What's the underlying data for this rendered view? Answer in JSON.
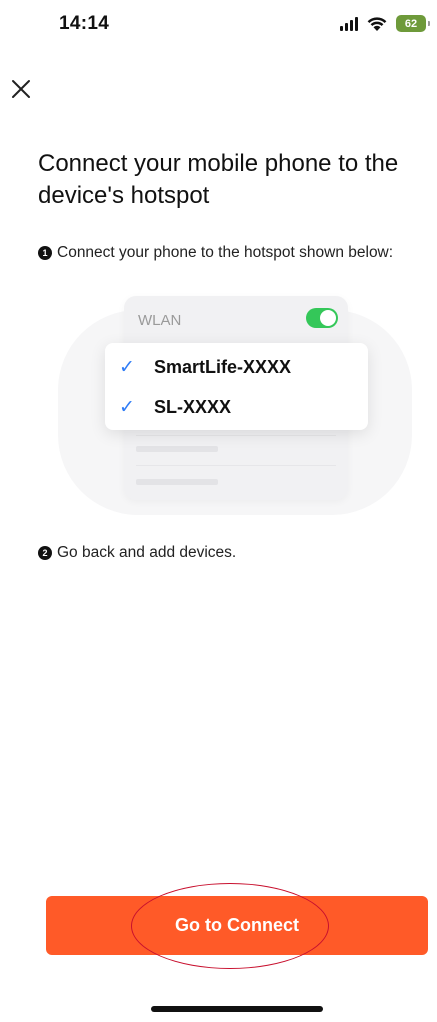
{
  "status_bar": {
    "time": "14:14",
    "battery": "62",
    "icons": [
      "signal-icon",
      "wifi-icon",
      "battery-icon"
    ]
  },
  "header": {
    "close_icon": "close-icon"
  },
  "title": "Connect your mobile phone to the device's hotspot",
  "steps": [
    {
      "number": "1",
      "text": "Connect your phone to the hotspot shown below:"
    },
    {
      "number": "2",
      "text": "Go back and add devices."
    }
  ],
  "illustration": {
    "wlan_label": "WLAN",
    "wlan_enabled": true,
    "networks": [
      {
        "name": "SmartLife-XXXX",
        "checked": true
      },
      {
        "name": "SL-XXXX",
        "checked": true
      }
    ]
  },
  "action": {
    "button_label": "Go to Connect"
  },
  "colors": {
    "accent": "#ff5a28",
    "toggle_on": "#34c759",
    "checkmark": "#2f7cf6",
    "annotation": "#c8102e",
    "battery": "#6e9a3a"
  }
}
